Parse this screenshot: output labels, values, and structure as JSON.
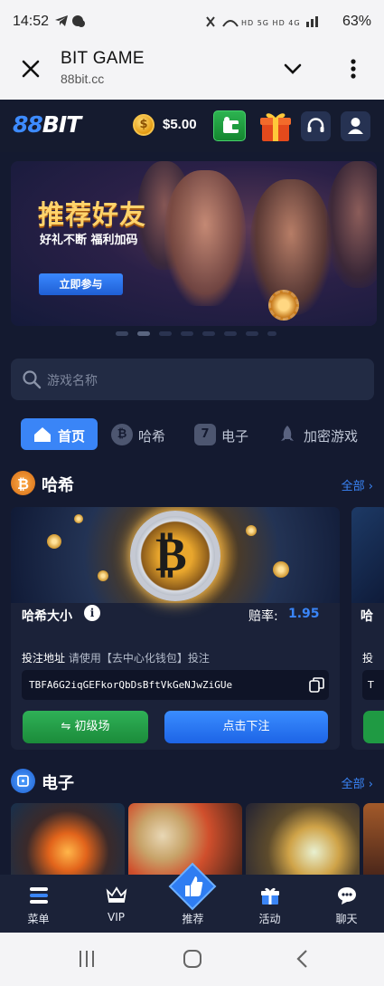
{
  "status_bar": {
    "time": "14:52",
    "battery": "63%",
    "signal_labels": "HD 5G HD 4G"
  },
  "browser": {
    "title": "BIT GAME",
    "url": "88bit.cc"
  },
  "header": {
    "logo_a": "88",
    "logo_b": "BIT",
    "balance": "$5.00"
  },
  "banner": {
    "title": "推荐好友",
    "subtitle": "好礼不断  福利加码",
    "cta": "立即参与"
  },
  "search": {
    "placeholder": "游戏名称"
  },
  "categories": [
    {
      "label": "首页",
      "icon": "home-icon"
    },
    {
      "label": "哈希",
      "icon": "bitcoin-icon"
    },
    {
      "label": "电子",
      "icon": "seven-icon"
    },
    {
      "label": "加密游戏",
      "icon": "rocket-icon"
    }
  ],
  "hash_section": {
    "title": "哈希",
    "all": "全部"
  },
  "hash_card": {
    "name": "哈希大小",
    "info": "i",
    "odds_label": "赔率:",
    "odds_value": "1.95",
    "address_label": "投注地址",
    "address_hint": "请使用【去中心化钱包】投注",
    "address": "TBFA6G2iqGEFkorQbDsBftVkGeNJwZiGUe",
    "level_button": "⇋ 初级场",
    "bet_button": "点击下注"
  },
  "hash_card_peek": {
    "name_char": "哈",
    "addr_char": "投",
    "box_char": "T"
  },
  "electronic_section": {
    "title": "电子",
    "all": "全部"
  },
  "bottom_nav": [
    {
      "label": "菜单",
      "icon": "menu-icon"
    },
    {
      "label": "VIP",
      "icon": "crown-icon"
    },
    {
      "label": "推荐",
      "icon": "thumbs-up-icon"
    },
    {
      "label": "活动",
      "icon": "gift-icon"
    },
    {
      "label": "聊天",
      "icon": "chat-icon"
    }
  ],
  "colors": {
    "accent": "#3a85f7",
    "background": "#141a30",
    "green": "#2fb157"
  }
}
